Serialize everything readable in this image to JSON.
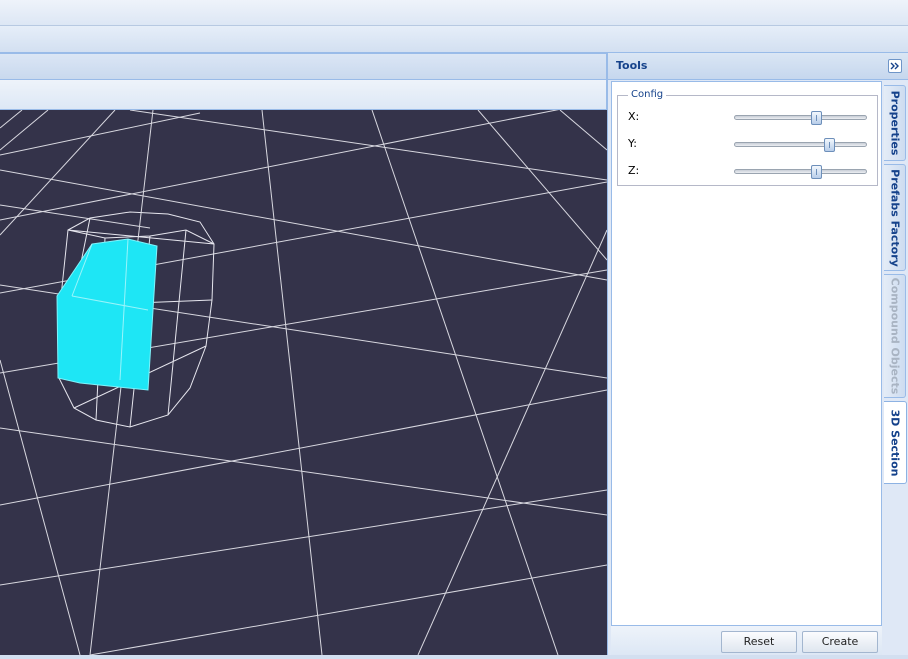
{
  "tools": {
    "title": "Tools",
    "config_legend": "Config",
    "sliders": [
      {
        "label": "X:",
        "value": 0.62
      },
      {
        "label": "Y:",
        "value": 0.73
      },
      {
        "label": "Z:",
        "value": 0.62
      }
    ],
    "reset_label": "Reset",
    "create_label": "Create"
  },
  "side_tabs": [
    {
      "label": "Properties",
      "state": "normal"
    },
    {
      "label": "Prefabs Factory",
      "state": "normal"
    },
    {
      "label": "Compound Objects",
      "state": "disabled"
    },
    {
      "label": "3D Section",
      "state": "active"
    }
  ],
  "colors": {
    "scene_background": "#34334a",
    "grid_lines": "#d8d8e0",
    "section_fill": "#1ee6f5",
    "panel_header_text": "#15428b"
  }
}
